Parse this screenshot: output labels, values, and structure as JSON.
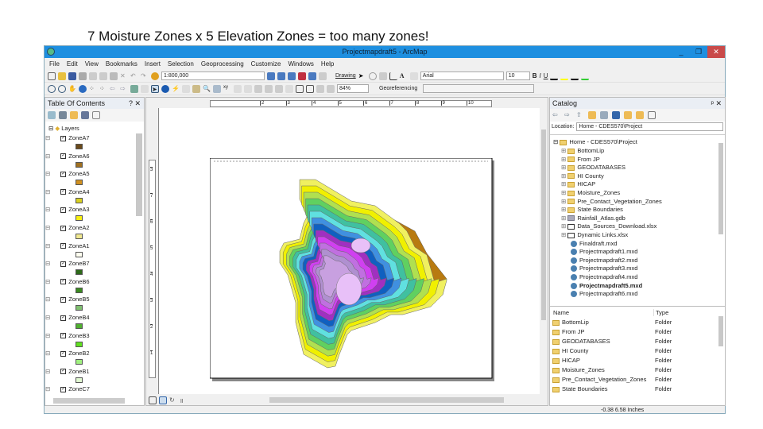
{
  "slide_title": "7  Moisture Zones x 5 Elevation Zones = too many zones!",
  "window": {
    "title": "Projectmapdraft5 - ArcMap",
    "minimize": "_",
    "maximize": "❐",
    "close": "✕"
  },
  "menu": [
    "File",
    "Edit",
    "View",
    "Bookmarks",
    "Insert",
    "Selection",
    "Geoprocessing",
    "Customize",
    "Windows",
    "Help"
  ],
  "toolbar": {
    "scale": "1:800,000",
    "drawing": "Drawing",
    "font": "Arial",
    "font_size": "10",
    "bold": "B",
    "italic": "I",
    "underline": "U",
    "zoom": "84%",
    "georeferencing": "Georeferencing"
  },
  "toc": {
    "title": "Table Of Contents",
    "pin": "? ✕",
    "root": "Layers",
    "layers": [
      {
        "name": "ZoneA7",
        "color": "#6b4a1a"
      },
      {
        "name": "ZoneA6",
        "color": "#a07020"
      },
      {
        "name": "ZoneA5",
        "color": "#d09020"
      },
      {
        "name": "ZoneA4",
        "color": "#d8d020"
      },
      {
        "name": "ZoneA3",
        "color": "#f8f010"
      },
      {
        "name": "ZoneA2",
        "color": "#f0e890"
      },
      {
        "name": "ZoneA1",
        "color": "#fffff0"
      },
      {
        "name": "ZoneB7",
        "color": "#2e6a1a"
      },
      {
        "name": "ZoneB6",
        "color": "#3a8a20"
      },
      {
        "name": "ZoneB5",
        "color": "#80c070"
      },
      {
        "name": "ZoneB4",
        "color": "#50b030"
      },
      {
        "name": "ZoneB3",
        "color": "#60e020"
      },
      {
        "name": "ZoneB2",
        "color": "#a0f080"
      },
      {
        "name": "ZoneB1",
        "color": "#e0f8d0"
      },
      {
        "name": "ZoneC7",
        "color": null
      }
    ]
  },
  "ruler": {
    "top": [
      "2",
      "3",
      "4",
      "5",
      "6",
      "7",
      "8",
      "9",
      "10"
    ],
    "left": [
      "3",
      "7",
      "6",
      "5",
      "4",
      "3",
      "2",
      "1"
    ]
  },
  "map": {
    "zone_colors": [
      "#f0f060",
      "#f0f000",
      "#b0e050",
      "#60d060",
      "#40c0a0",
      "#60e0e0",
      "#4090e0",
      "#1060c0",
      "#a030c0",
      "#d040f0",
      "#c070e0",
      "#b090d0",
      "#c8a0e0"
    ]
  },
  "catalog": {
    "title": "Catalog",
    "pin": "ᵖ ✕",
    "location_label": "Location:",
    "location": "Home - CDES570\\Project",
    "tree_root": "Home - CDES570\\Project",
    "tree": [
      {
        "name": "BottomLip",
        "kind": "folder"
      },
      {
        "name": "From JP",
        "kind": "folder"
      },
      {
        "name": "GEODATABASES",
        "kind": "folder"
      },
      {
        "name": "HI County",
        "kind": "folder"
      },
      {
        "name": "HICAP",
        "kind": "folder"
      },
      {
        "name": "Moisture_Zones",
        "kind": "folder"
      },
      {
        "name": "Pre_Contact_Vegetation_Zones",
        "kind": "folder"
      },
      {
        "name": "State Boundaries",
        "kind": "folder"
      },
      {
        "name": "Rainfall_Atlas.gdb",
        "kind": "gdb"
      },
      {
        "name": "Data_Sources_Download.xlsx",
        "kind": "xls"
      },
      {
        "name": "Dynamic Links.xlsx",
        "kind": "xls"
      },
      {
        "name": "Finaldraft.mxd",
        "kind": "mxd"
      },
      {
        "name": "Projectmapdraft1.mxd",
        "kind": "mxd"
      },
      {
        "name": "Projectmapdraft2.mxd",
        "kind": "mxd"
      },
      {
        "name": "Projectmapdraft3.mxd",
        "kind": "mxd"
      },
      {
        "name": "Projectmapdraft4.mxd",
        "kind": "mxd"
      },
      {
        "name": "Projectmapdraft5.mxd",
        "kind": "mxd"
      },
      {
        "name": "Projectmapdraft6.mxd",
        "kind": "mxd"
      }
    ],
    "cols": [
      "Name",
      "Type"
    ],
    "rows": [
      [
        "BottomLip",
        "Folder"
      ],
      [
        "From JP",
        "Folder"
      ],
      [
        "GEODATABASES",
        "Folder"
      ],
      [
        "HI County",
        "Folder"
      ],
      [
        "HICAP",
        "Folder"
      ],
      [
        "Moisture_Zones",
        "Folder"
      ],
      [
        "Pre_Contact_Vegetation_Zones",
        "Folder"
      ],
      [
        "State Boundaries",
        "Folder"
      ]
    ]
  },
  "status": {
    "coords": "-0.38  6.58 Inches"
  }
}
